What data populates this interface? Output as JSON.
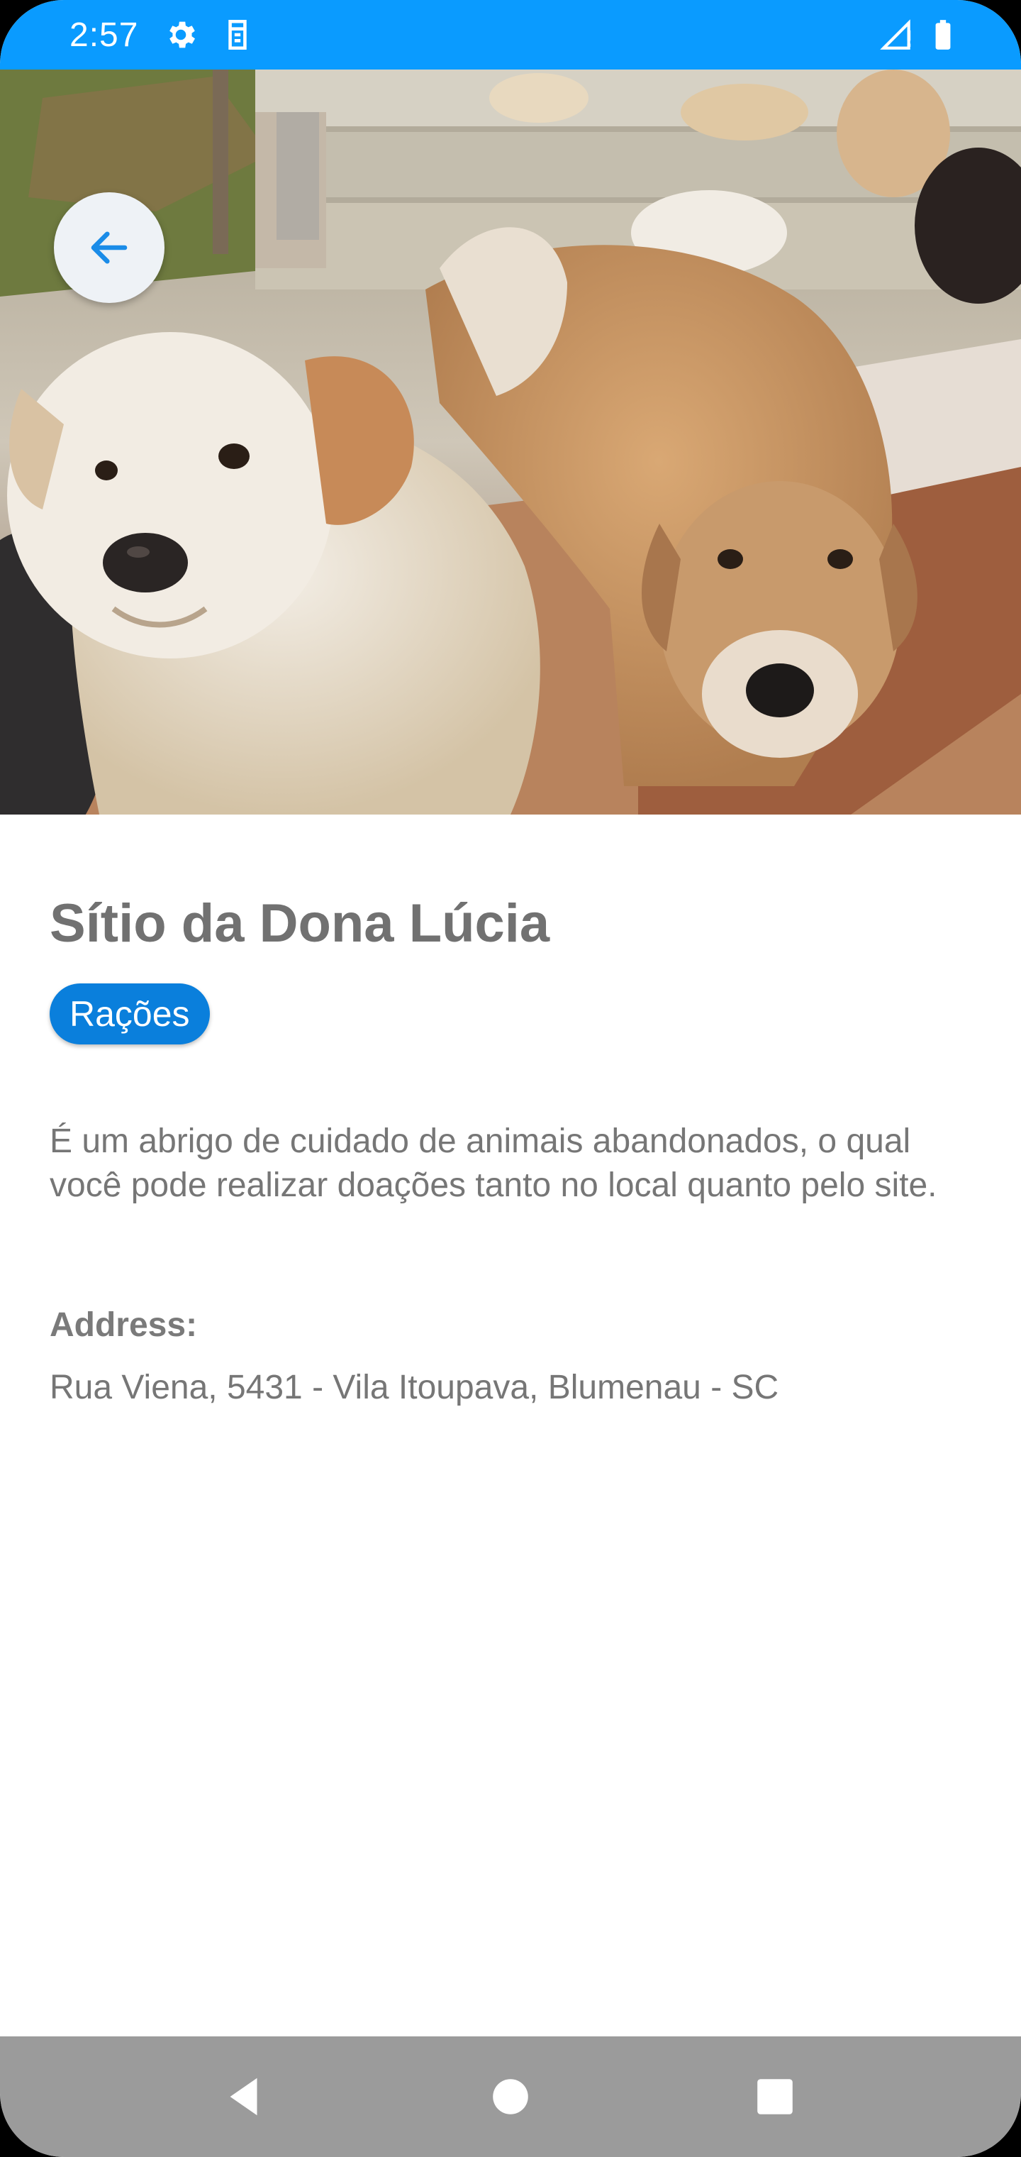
{
  "status_bar": {
    "time": "2:57",
    "icons": [
      "settings-icon",
      "sim-icon",
      "signal-icon",
      "battery-icon"
    ],
    "background_color": "#0a9bff"
  },
  "hero": {
    "image_description_icon": "dogs-photo",
    "back_icon": "arrow-left-icon"
  },
  "place": {
    "title": "Sítio da Dona Lúcia",
    "category": "Rações",
    "description": "É um abrigo de cuidado de animais abandonados, o qual você pode realizar doações tanto no local quanto pelo site.",
    "address_label": "Address:",
    "address": "Rua Viena, 5431 - Vila Itoupava, Blumenau - SC"
  },
  "nav_bar": {
    "buttons": [
      "back-triangle-icon",
      "home-circle-icon",
      "recents-square-icon"
    ]
  },
  "colors": {
    "accent": "#0a7fdc",
    "text": "#767676",
    "title": "#717171"
  }
}
